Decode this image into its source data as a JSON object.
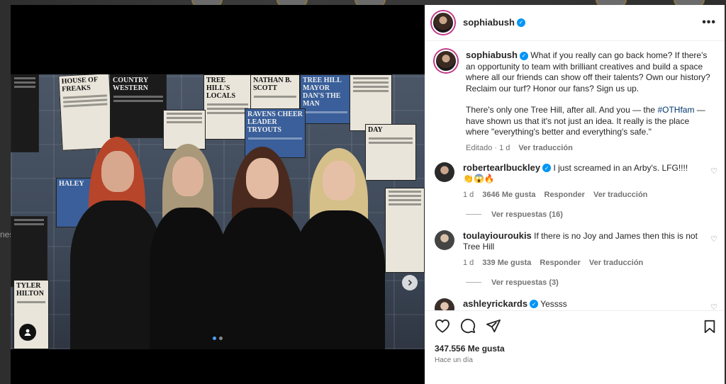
{
  "post": {
    "author": "sophiabush",
    "more_label": "•••",
    "caption_p1": "What if you really can go back home? If there's an opportunity to team with brilliant creatives and build a space where all our friends can show off their talents? Own our history? Reclaim our turf? Honor our fans? Sign us up.",
    "caption_p2a": "There's only one Tree Hill, after all. And you — the ",
    "caption_hashtag": "#OTHfam",
    "caption_p2b": " — have shown us that it's not just an idea. It really is the place where \"everything's better and everything's safe.\"",
    "edited": "Editado",
    "time": "1 d",
    "see_translation": "Ver traducción"
  },
  "comments": [
    {
      "user": "robertearlbuckley",
      "verified": true,
      "text": "I just screamed in an Arby's. LFG!!!! 👏😱🔥",
      "time": "1 d",
      "likes": "3646 Me gusta",
      "reply": "Responder",
      "translate": "Ver traducción",
      "replies": "Ver respuestas (16)"
    },
    {
      "user": "toulayiouroukis",
      "verified": false,
      "text": "If there is no Joy and James then this is not Tree Hill",
      "time": "1 d",
      "likes": "339 Me gusta",
      "reply": "Responder",
      "translate": "Ver traducción",
      "replies": "Ver respuestas (3)"
    },
    {
      "user": "ashleyrickards",
      "verified": true,
      "text": "Yessss"
    }
  ],
  "footer": {
    "likes": "347.556 Me gusta",
    "posted": "Hace un día"
  },
  "photo": {
    "posters": [
      "HOUSE OF FREAKS",
      "COUNTRY WESTERN",
      "TREE HILL'S LOCALS",
      "TREE HILL MAYOR DAN'S THE MAN",
      "RAVENS CHEER LEADER TRYOUTS",
      "HALEY",
      "TYLER HILTON",
      "NATHAN B. SCOTT",
      "DAY"
    ],
    "side_text": "nes"
  },
  "colors": {
    "accent": "#0095f6",
    "hashtag": "#00376b"
  }
}
